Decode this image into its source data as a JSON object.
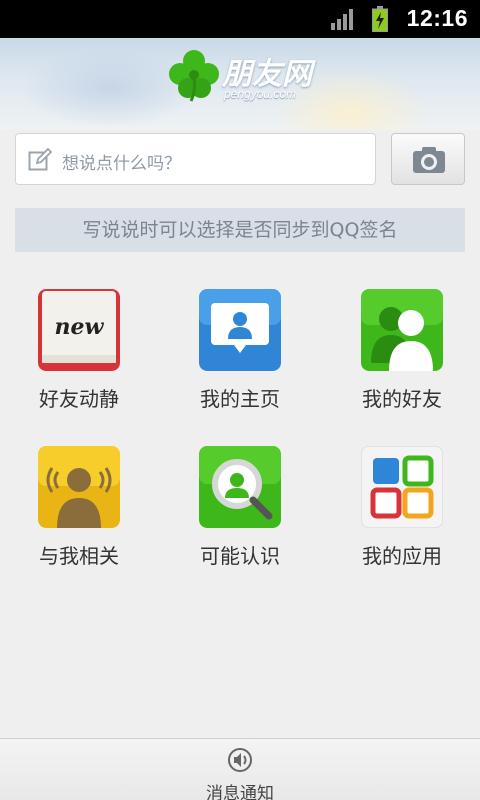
{
  "status_bar": {
    "time": "12:16",
    "signal_icon": "signal-bars-icon",
    "battery_icon": "battery-charging-icon"
  },
  "header": {
    "brand_name": "朋友网",
    "brand_domain": "pengyou.com",
    "logo_icon": "clover-icon"
  },
  "compose": {
    "placeholder": "想说点什么吗？",
    "edit_icon": "edit-icon",
    "camera_icon": "camera-icon"
  },
  "tip": {
    "text": "写说说时可以选择是否同步到QQ签名"
  },
  "grid": {
    "items": [
      {
        "label": "好友动静",
        "icon": "friend-feed-icon",
        "icon_text": "new"
      },
      {
        "label": "我的主页",
        "icon": "my-homepage-icon"
      },
      {
        "label": "我的好友",
        "icon": "my-friends-icon"
      },
      {
        "label": "与我相关",
        "icon": "related-to-me-icon"
      },
      {
        "label": "可能认识",
        "icon": "people-you-may-know-icon"
      },
      {
        "label": "我的应用",
        "icon": "my-apps-icon"
      }
    ]
  },
  "bottom_bar": {
    "label": "消息通知",
    "icon": "speaker-icon"
  },
  "colors": {
    "header_top": "#c9d9e8",
    "tip_bg": "#d9dfe6",
    "green": "#3db71a",
    "blue": "#2f86d6",
    "red": "#d9333a",
    "yellow": "#f2c61d"
  }
}
